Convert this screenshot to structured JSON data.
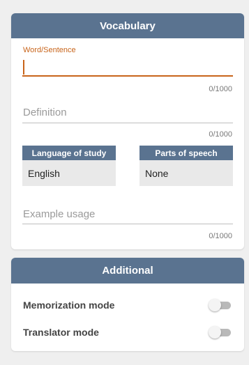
{
  "vocabulary": {
    "title": "Vocabulary",
    "word_field": {
      "label": "Word/Sentence",
      "value": "",
      "counter": "0/1000"
    },
    "definition_field": {
      "placeholder": "Definition",
      "value": "",
      "counter": "0/1000"
    },
    "language_select": {
      "label": "Language of study",
      "value": "English"
    },
    "parts_of_speech_select": {
      "label": "Parts of speech",
      "value": "None"
    },
    "example_field": {
      "placeholder": "Example usage",
      "value": "",
      "counter": "0/1000"
    }
  },
  "additional": {
    "title": "Additional",
    "memorization_mode": {
      "label": "Memorization mode",
      "enabled": false
    },
    "translator_mode": {
      "label": "Translator mode",
      "enabled": false
    }
  },
  "colors": {
    "header": "#5a7390",
    "accent": "#c8641a",
    "background": "#efefef"
  }
}
